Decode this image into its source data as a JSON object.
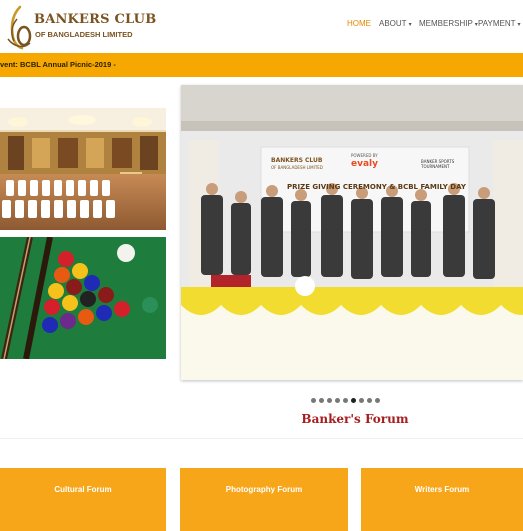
{
  "brand": {
    "name": "BANKERS CLUB",
    "subtitle": "OF BANGLADESH LIMITED",
    "color": "#7a5320"
  },
  "nav": {
    "items": [
      {
        "label": "HOME",
        "active": true
      },
      {
        "label": "ABOUT",
        "caret": "▾"
      },
      {
        "label": "MEMBERSHIP",
        "caret": "▾"
      },
      {
        "label": "PAYMENT",
        "caret": "▾"
      }
    ],
    "active_color": "#e08a00"
  },
  "ticker": {
    "text": "vent: BCBL Annual Picnic-2019 -",
    "background": "#f6a800"
  },
  "slider": {
    "banner_logo": "BANKERS CLUB",
    "banner_logo_sub": "OF BANGLADESH LIMITED",
    "banner_sponsor": "evaly",
    "banner_sponsor_pre": "POWERED BY",
    "banner_right": "BANKER SPORTS TOURNAMENT",
    "banner_title": "PRIZE GIVING CEREMONY & BCBL FAMILY DAY",
    "dot_count": 9,
    "active_dot": 5
  },
  "section": {
    "title": "Banker's Forum",
    "title_color": "#a71d1d"
  },
  "forums": [
    {
      "label": "Cultural Forum"
    },
    {
      "label": "Photography Forum"
    },
    {
      "label": "Writers Forum"
    }
  ],
  "forum_color": "#f7a61a"
}
